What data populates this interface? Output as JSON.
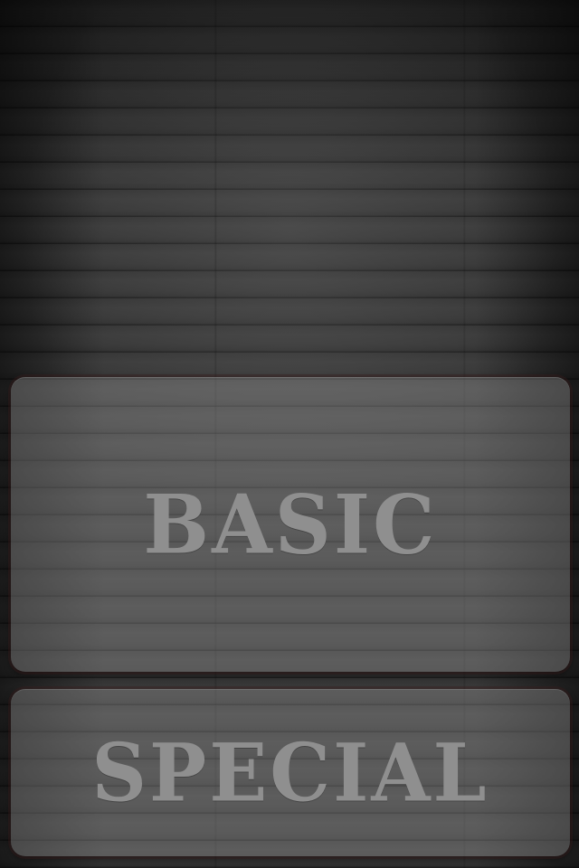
{
  "menu": {
    "buttons": [
      {
        "id": "basic",
        "label": "BASIC"
      },
      {
        "id": "special",
        "label": "SPECIAL"
      }
    ]
  },
  "colors": {
    "background_wood": "#2c2c2c",
    "button_fill": "#969696",
    "label_text": "#8f8f8f"
  }
}
